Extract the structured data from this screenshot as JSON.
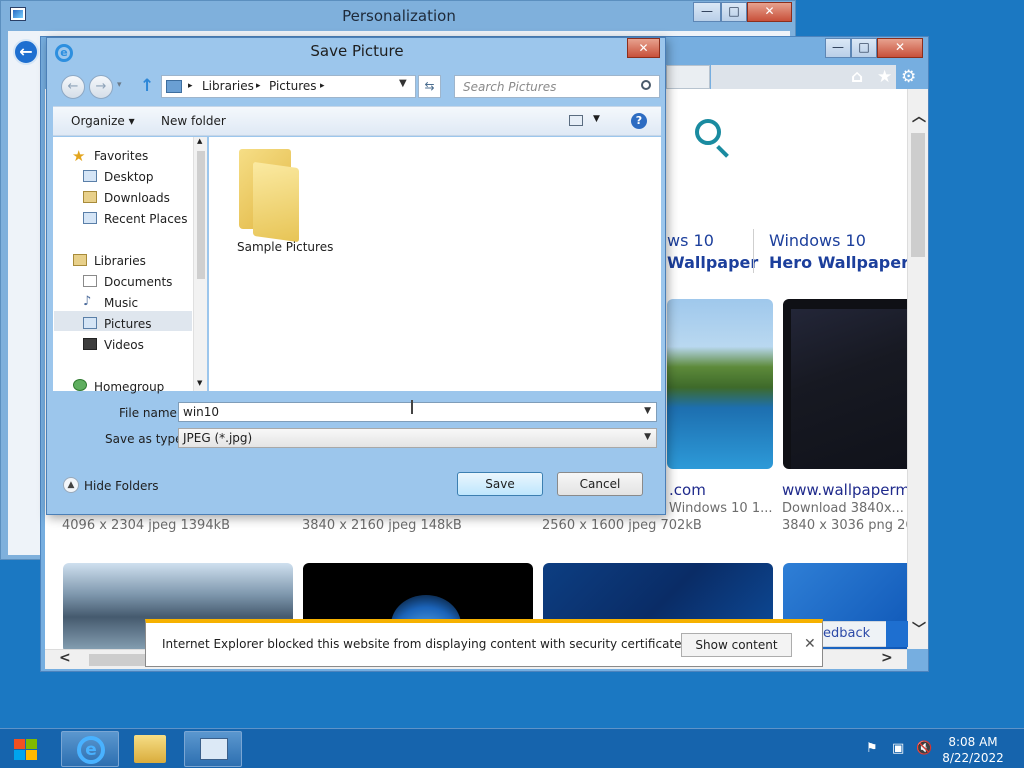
{
  "personalization_window": {
    "title": "Personalization",
    "buttons": {
      "minimize": "—",
      "maximize": "□",
      "close": "✕"
    }
  },
  "ie_window": {
    "buttons": {
      "minimize": "—",
      "maximize": "□",
      "close": "✕"
    },
    "command_icons": [
      "home-icon",
      "star-icon",
      "gear-icon"
    ],
    "page": {
      "categories": [
        {
          "line1": "ws 10",
          "line2": "Wallpaper"
        },
        {
          "line1": "Windows 10",
          "line2": "Hero Wallpaper"
        }
      ],
      "results": [
        {
          "site": ".com",
          "desc": "Windows 10 1...",
          "meta": "2560 x 1600 jpeg 702kB"
        },
        {
          "site": "www.wallpaperm",
          "desc": "Download 3840x...",
          "meta": "3840 x 3036 png 26"
        }
      ],
      "row_meta_left": [
        "4096 x 2304 jpeg 1394kB",
        "3840 x 2160 jpeg 148kB"
      ],
      "feedback": "edback"
    },
    "notification": {
      "message": "Internet Explorer blocked this website from displaying content with security certificate errors.",
      "button": "Show content",
      "close": "✕"
    }
  },
  "dialog": {
    "title": "Save Picture",
    "close": "✕",
    "breadcrumb": [
      "Libraries",
      "Pictures"
    ],
    "search_placeholder": "Search Pictures",
    "toolbar": {
      "organize": "Organize ▾",
      "new_folder": "New folder",
      "help": "?"
    },
    "nav": {
      "favorites": "Favorites",
      "favorites_items": [
        "Desktop",
        "Downloads",
        "Recent Places"
      ],
      "libraries": "Libraries",
      "libraries_items": [
        "Documents",
        "Music",
        "Pictures",
        "Videos"
      ],
      "homegroup": "Homegroup"
    },
    "files": [
      {
        "name": "Sample Pictures"
      }
    ],
    "file_name_label": "File name:",
    "file_name_value": "win10",
    "save_as_type_label": "Save as type:",
    "save_as_type_value": "JPEG (*.jpg)",
    "hide_folders": "Hide Folders",
    "save_button": "Save",
    "cancel_button": "Cancel"
  },
  "taskbar": {
    "time": "8:08 AM",
    "date": "8/22/2022"
  }
}
